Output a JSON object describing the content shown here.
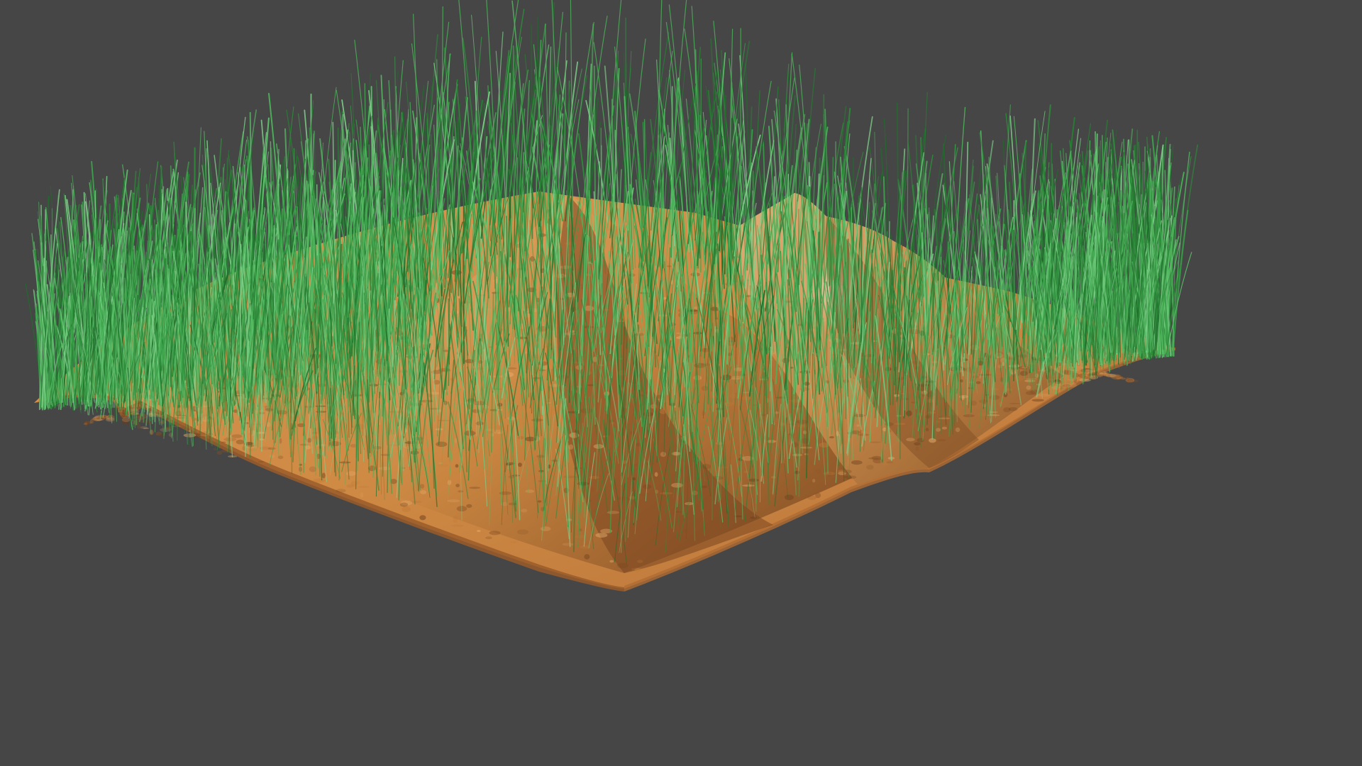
{
  "scene": {
    "background_color": "#464646",
    "soil_colors": {
      "base": "#d4914a",
      "light": "#e7b070",
      "mid": "#c07a38",
      "shadow": "#8a5226",
      "dark": "#6b3d1b",
      "pale_rock": "#e8c9a0"
    },
    "grass_colors": [
      "#2e8b3a",
      "#3aa24a",
      "#4cb45a",
      "#268033",
      "#1f6e2b",
      "#5bc26a",
      "#7fd08a"
    ],
    "objects": [
      {
        "name": "terrain-plane",
        "kind": "terrain",
        "label": ""
      },
      {
        "name": "grass-particles",
        "kind": "hair-particles",
        "label": ""
      }
    ]
  }
}
